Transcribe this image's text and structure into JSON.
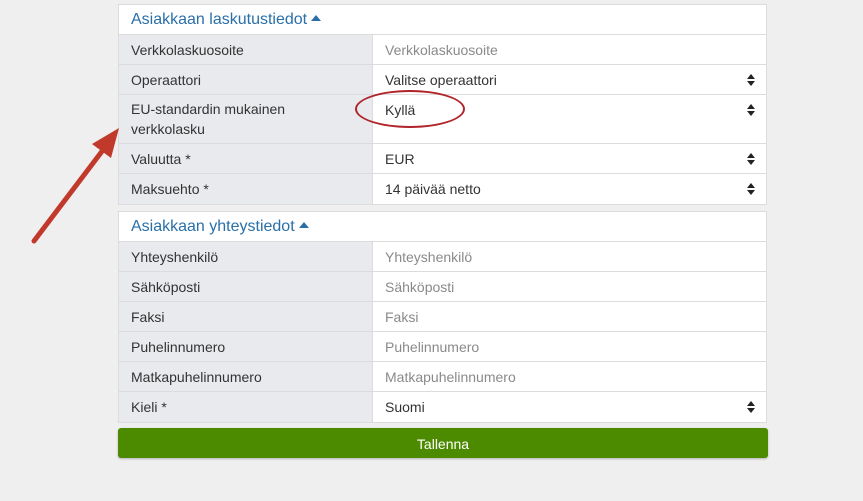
{
  "billing": {
    "title": "Asiakkaan laskutustiedot",
    "rows": [
      {
        "label": "Verkkolaskuosoite",
        "value": "",
        "placeholder": "Verkkolaskuosoite"
      },
      {
        "label": "Operaattori",
        "value": "Valitse operaattori"
      },
      {
        "label": "EU-standardin mukainen verkkolasku",
        "value": "Kyllä"
      },
      {
        "label": "Valuutta *",
        "value": "EUR"
      },
      {
        "label": "Maksuehto *",
        "value": "14 päivää netto"
      }
    ]
  },
  "contact": {
    "title": "Asiakkaan yhteystiedot",
    "rows": [
      {
        "label": "Yhteyshenkilö",
        "placeholder": "Yhteyshenkilö"
      },
      {
        "label": "Sähköposti",
        "placeholder": "Sähköposti"
      },
      {
        "label": "Faksi",
        "placeholder": "Faksi"
      },
      {
        "label": "Puhelinnumero",
        "placeholder": "Puhelinnumero"
      },
      {
        "label": "Matkapuhelinnumero",
        "placeholder": "Matkapuhelinnumero"
      },
      {
        "label": "Kieli *",
        "value": "Suomi"
      }
    ]
  },
  "save_label": "Tallenna",
  "colors": {
    "accent_link": "#2a6fa8",
    "save_button": "#4c8a00",
    "annotation": "#c0392b"
  }
}
